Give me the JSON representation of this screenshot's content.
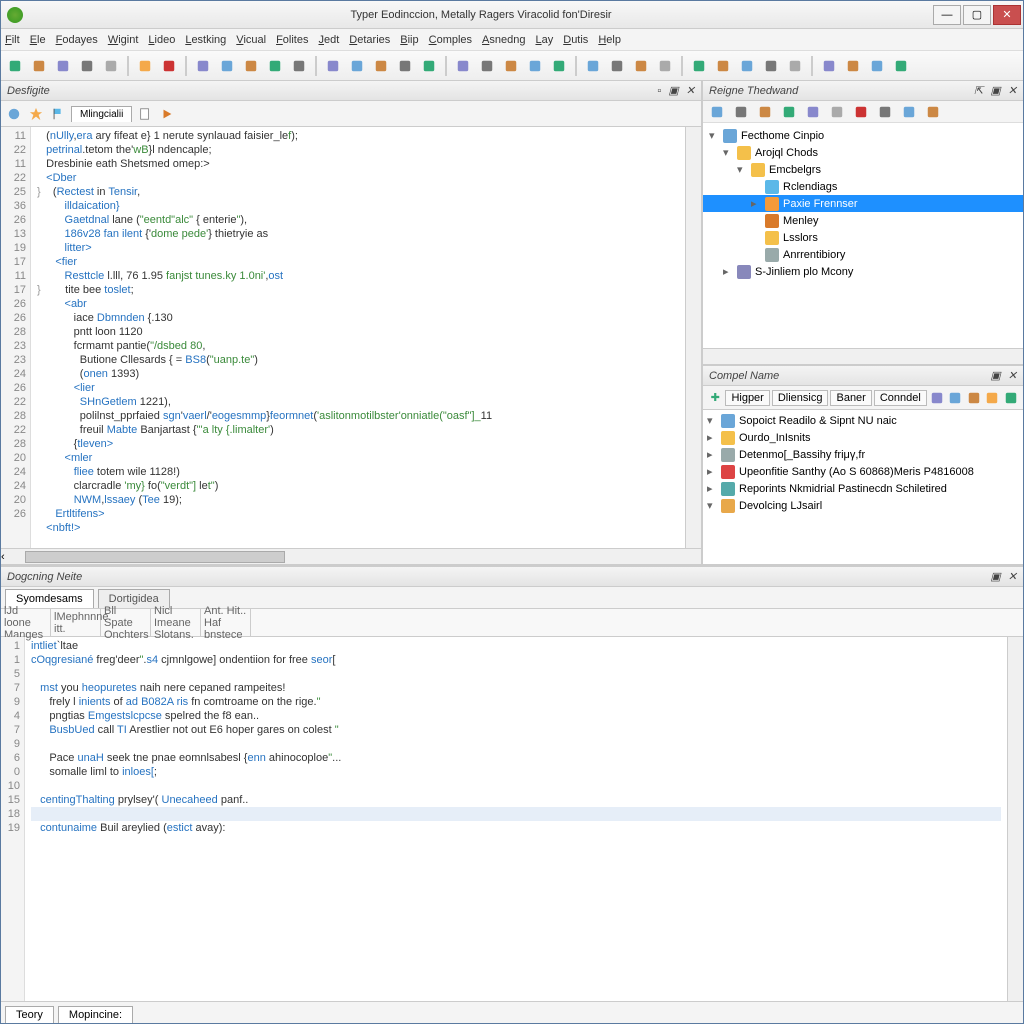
{
  "title": "Typer Eodinccion, Metally Ragers Viracolid fon'Diresir",
  "menu": [
    "Filt",
    "Ele",
    "Fodayes",
    "Wigint",
    "Lideo",
    "Lestking",
    "Vicual",
    "Folites",
    "Jedt",
    "Detaries",
    "Biip",
    "Comples",
    "Asnedng",
    "Lay",
    "Dutis",
    "Help"
  ],
  "editor": {
    "panel_title": "Desfigite",
    "tab": "Mlingcialii",
    "gutter": [
      "11",
      "22",
      "",
      "11",
      "22",
      "25",
      "36",
      "26",
      "13",
      "19",
      "17",
      "11",
      "17",
      "26",
      "26",
      "28",
      "23",
      "23",
      "24",
      "26",
      "22",
      "28",
      "22",
      "28",
      "20",
      "24",
      "24",
      "20",
      "26"
    ],
    "lines": [
      {
        "t": "   (<kw>nUlly</kw>,<kw>era</kw> ary fifeat e} 1 nerute synlauad faisier_le<str>f</str>);"
      },
      {
        "t": "   <kw>petrinal</kw>.tetom the'<str>wB</str>}l ndencaple;"
      },
      {
        "t": ""
      },
      {
        "t": "   Dresbinie eath Shetsmed omep:>"
      },
      {
        "t": "   <kw>&lt;Dber</kw>"
      },
      {
        "t": "<cm>}</cm>    (<kw>Rectest</kw> in <kw>Tensir</kw>,"
      },
      {
        "t": "         <kw>illdaication}</kw>"
      },
      {
        "t": "         <kw>Gaetdnal</kw> lane (<str>\"eentd\"alc\"</str> { enterie<str>\"</str>),"
      },
      {
        "t": "         <kw>186v28 fan ilent</kw> {'<str>dome pede'</str>} thietryie as"
      },
      {
        "t": "         <kw>litter&gt;</kw>"
      },
      {
        "t": "      <kw>&lt;fier</kw>"
      },
      {
        "t": "         <kw>Resttcle</kw> l.lll, 76 1.95 <str>fanjst tunes.ky 1.0ni'</str>,<kw>ost</kw>"
      },
      {
        "t": "<cm>}</cm>        tite bee <kw>toslet</kw>;"
      },
      {
        "t": "         <kw>&lt;abr</kw>"
      },
      {
        "t": "            iace <kw>Dbmnden</kw> {.130"
      },
      {
        "t": "            pntt loon 1120"
      },
      {
        "t": "            fcrmamt pantie(<str>\"/dsbed 80</str>,"
      },
      {
        "t": "              Butione Cllesards { = <kw>BS8</kw>(<str>\"uanp.te\"</str>)"
      },
      {
        "t": "              (<kw>onen</kw> 1393)"
      },
      {
        "t": "            <kw>&lt;lier</kw>"
      },
      {
        "t": "              <kw>SHnGetlem</kw> 1221),"
      },
      {
        "t": "              polilnst_pprfaied <kw>sgn</kw>'<kw>vaerl</kw>/'<kw>eogesmmp</kw>}<kw>feormnet</kw>(<str>'aslitonmotilbster'onniatle(\"oasf\"]_</str>11"
      },
      {
        "t": "              freuil <kw>Mabte</kw> Banjartast {<str>\"'a lty {.limalter'</str>)"
      },
      {
        "t": "            {<kw>tleven&gt;</kw>"
      },
      {
        "t": "         <kw>&lt;mler</kw>"
      },
      {
        "t": "            <kw>fliee</kw> totem wile 1128!)"
      },
      {
        "t": "            clarcradle <str>'my}</str> fo(<str>\"verdt\"]</str> le<str>t\"</str>)"
      },
      {
        "t": "            <kw>NWM</kw>,<kw>lssaey</kw> (<kw>Tee</kw> 19);"
      },
      {
        "t": "      <kw>Ertltifens&gt;</kw>"
      },
      {
        "t": "   <kw>&lt;nbft!&gt;</kw>"
      }
    ]
  },
  "project": {
    "panel_title": "Reigne Thedwand",
    "items": [
      {
        "depth": 0,
        "tw": "▾",
        "icon": "#6aa6d8",
        "label": "Fecthome Cinpio"
      },
      {
        "depth": 1,
        "tw": "▾",
        "icon": "#f4c04a",
        "label": "Arojql Chods"
      },
      {
        "depth": 2,
        "tw": "▾",
        "icon": "#f4c04a",
        "label": "Emcbelgrs"
      },
      {
        "depth": 3,
        "tw": "",
        "icon": "#5bb8e8",
        "label": "Rclendiags"
      },
      {
        "depth": 3,
        "tw": "▸",
        "icon": "#f49a3a",
        "label": "Paxie Frennser",
        "sel": true
      },
      {
        "depth": 3,
        "tw": "",
        "icon": "#d97a2a",
        "label": "Menley"
      },
      {
        "depth": 3,
        "tw": "",
        "icon": "#f4c04a",
        "label": "Lsslors"
      },
      {
        "depth": 3,
        "tw": "",
        "icon": "#9aa",
        "label": "Anrrentibiory"
      },
      {
        "depth": 1,
        "tw": "▸",
        "icon": "#88b",
        "label": "S-Jinliem plo Mcony"
      }
    ]
  },
  "compel": {
    "panel_title": "Compel Name",
    "pills": [
      "Higper",
      "Dliensicg",
      "Baner",
      "Conndel"
    ],
    "items": [
      {
        "tw": "▾",
        "icon": "#6aa6d8",
        "label": "Sopoict Readilo & Sipnt NU naic"
      },
      {
        "tw": "▸",
        "icon": "#f4c04a",
        "label": "Ourdo_InIsnits"
      },
      {
        "tw": "▸",
        "icon": "#9aa",
        "label": "Detenmo[_Bassihy friμγ,fr"
      },
      {
        "tw": "▸",
        "icon": "#d44",
        "label": "Upeonfitie Santhy (Ao S 60868)Meris P4816008"
      },
      {
        "tw": "▸",
        "icon": "#5aa",
        "label": "Reporints Nkmidrial Pastinecdn Schiletired"
      },
      {
        "tw": "▾",
        "icon": "#e8a84a",
        "label": "Devolcing LJsairl"
      }
    ]
  },
  "console": {
    "panel_title": "Dogcning Neite",
    "tabs": [
      "Syomdesams",
      "Dortigidea"
    ],
    "subtabs": [
      [
        "lJd loone",
        "Manges"
      ],
      [
        "lMephnnne.",
        "itt."
      ],
      [
        "Bll Spate",
        "Onchters"
      ],
      [
        "Nicl Imeane",
        "Slotans."
      ],
      [
        "Ant. Hit..",
        "Haf bnstece"
      ]
    ],
    "gutter": [
      "1",
      "1",
      "5",
      "7",
      "9",
      "4",
      "7",
      "9",
      "6",
      "0",
      "10",
      "15",
      "18",
      "19"
    ],
    "lines": [
      {
        "t": "<kw>intliet</kw>`ltae"
      },
      {
        "t": "<kw>cOqgresiané</kw> freg'deer<str>\"</str>.<kw>s4</kw> cjmnlgowe] ondentiion for free <kw>seor</kw>["
      },
      {
        "t": ""
      },
      {
        "t": "   <kw>mst</kw> you <kw>heopuretes</kw> naih nere cepaned rampeites!"
      },
      {
        "t": "      frely l <kw>inients</kw> of <kw>ad</kw> <kw>B082A</kw> <kw>ris</kw> fn comtroame on the rige.<str>\"</str>"
      },
      {
        "t": "      pngtias <kw>Emgestslcpcse</kw> spelred the f8 ean.."
      },
      {
        "t": "      <kw>BusbUed</kw> call <kw>TI</kw> Arestlier not out E6 hoper gares on colest <str>\"</str>"
      },
      {
        "t": ""
      },
      {
        "t": "      Pace <kw>unaH</kw> seek tne pnae eomnlsabesl {<kw>enn</kw> ahinocoploe<str>\"</str>..."
      },
      {
        "t": "      somalle liml to <kw>inloes[</kw>;"
      },
      {
        "t": ""
      },
      {
        "t": "   <kw>centingThalting</kw> prylsey'( <kw>Unecaheed</kw> panf.."
      },
      {
        "t": "",
        "hl": true
      },
      {
        "t": "   <kw>contunaime</kw> Buil areylied (<kw>estict</kw> avay):"
      }
    ]
  },
  "status": {
    "left": "Teory",
    "right": "Mopincine:"
  }
}
